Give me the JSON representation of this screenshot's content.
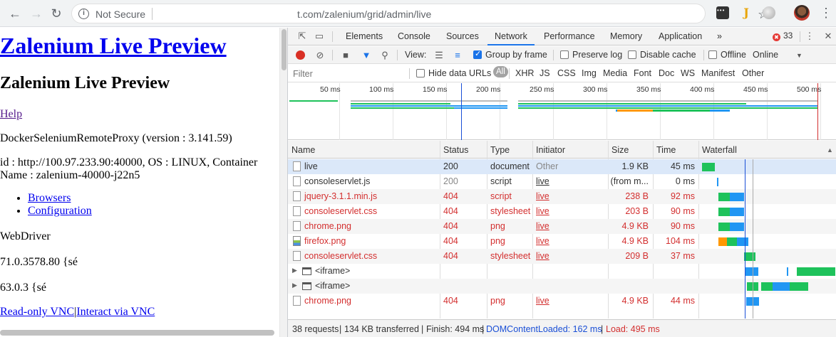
{
  "browser": {
    "back": "←",
    "forward": "→",
    "reload": "↻",
    "security": "Not Secure",
    "url": "t.com/zalenium/grid/admin/live",
    "bookmark": "☆",
    "ext_j": "J",
    "menu": "⋮"
  },
  "page": {
    "title": "Zalenium Live Preview",
    "heading": "Zalenium Live Preview",
    "help": "Help",
    "proxy": "DockerSeleniumRemoteProxy (version : 3.141.59)",
    "id_line1": "id : http://100.97.233.90:40000, OS : LINUX, Container",
    "id_line2": "Name : zalenium-40000-j22n5",
    "links": [
      "Browsers",
      "Configuration"
    ],
    "webdriver": "WebDriver",
    "chrome_version": "71.0.3578.80 {sé",
    "firefox_version": "63.0.3 {sé",
    "vnc_readonly": "Read-only VNC",
    "vnc_sep": "|",
    "vnc_interact": "Interact via VNC"
  },
  "devtools": {
    "tabs": [
      "Elements",
      "Console",
      "Sources",
      "Network",
      "Performance",
      "Memory",
      "Application"
    ],
    "active_tab": "Network",
    "more_tabs": "»",
    "error_count": "33",
    "error_glyph": "✖",
    "kebab": "⋮",
    "close": "✕",
    "toolbar": {
      "view": "View:",
      "group_by_frame": "Group by frame",
      "preserve_log": "Preserve log",
      "disable_cache": "Disable cache",
      "offline": "Offline",
      "throttle": "Online",
      "throttle_arrow": "▼"
    },
    "filter": {
      "placeholder": "Filter",
      "hide_data_urls": "Hide data URLs",
      "types": [
        "All",
        "XHR",
        "JS",
        "CSS",
        "Img",
        "Media",
        "Font",
        "Doc",
        "WS",
        "Manifest",
        "Other"
      ]
    },
    "overview_ticks": [
      "50 ms",
      "100 ms",
      "150 ms",
      "200 ms",
      "250 ms",
      "300 ms",
      "350 ms",
      "400 ms",
      "450 ms",
      "500 ms"
    ],
    "columns": [
      "Name",
      "Status",
      "Type",
      "Initiator",
      "Size",
      "Time",
      "Waterfall"
    ],
    "sort_arrow": "▲",
    "rows": [
      {
        "name": "live",
        "status": "200",
        "type": "document",
        "initiator": "Other",
        "size": "1.9 KB",
        "time": "45 ms",
        "kind": "ok",
        "icon": "doc"
      },
      {
        "name": "consoleservlet.js",
        "status": "200",
        "type": "script",
        "initiator": "live",
        "size": "(from m...",
        "time": "0 ms",
        "kind": "cached",
        "icon": "doc"
      },
      {
        "name": "jquery-3.1.1.min.js",
        "status": "404",
        "type": "script",
        "initiator": "live",
        "size": "238 B",
        "time": "92 ms",
        "kind": "err",
        "icon": "doc"
      },
      {
        "name": "consoleservlet.css",
        "status": "404",
        "type": "stylesheet",
        "initiator": "live",
        "size": "203 B",
        "time": "90 ms",
        "kind": "err",
        "icon": "doc"
      },
      {
        "name": "chrome.png",
        "status": "404",
        "type": "png",
        "initiator": "live",
        "size": "4.9 KB",
        "time": "90 ms",
        "kind": "err",
        "icon": "doc"
      },
      {
        "name": "firefox.png",
        "status": "404",
        "type": "png",
        "initiator": "live",
        "size": "4.9 KB",
        "time": "104 ms",
        "kind": "err",
        "icon": "img"
      },
      {
        "name": "consoleservlet.css",
        "status": "404",
        "type": "stylesheet",
        "initiator": "live",
        "size": "209 B",
        "time": "37 ms",
        "kind": "err",
        "icon": "doc"
      },
      {
        "name": "<iframe>",
        "status": "",
        "type": "",
        "initiator": "",
        "size": "",
        "time": "",
        "kind": "frame",
        "icon": "frame"
      },
      {
        "name": "<iframe>",
        "status": "",
        "type": "",
        "initiator": "",
        "size": "",
        "time": "",
        "kind": "frame",
        "icon": "frame"
      },
      {
        "name": "chrome.png",
        "status": "404",
        "type": "png",
        "initiator": "live",
        "size": "4.9 KB",
        "time": "44 ms",
        "kind": "err",
        "icon": "doc"
      }
    ],
    "status": {
      "requests": "38 requests",
      "transferred": "134 KB transferred",
      "finish": "Finish: 494 ms",
      "dcl": "DOMContentLoaded: 162 ms",
      "load": "Load: 495 ms",
      "sep": "|"
    },
    "colors": {
      "waiting": "#1ec25b",
      "download": "#2196f3",
      "queued": "#ff9800",
      "dcl_line": "#1a4fd6",
      "load_line": "#d32f2f"
    }
  }
}
